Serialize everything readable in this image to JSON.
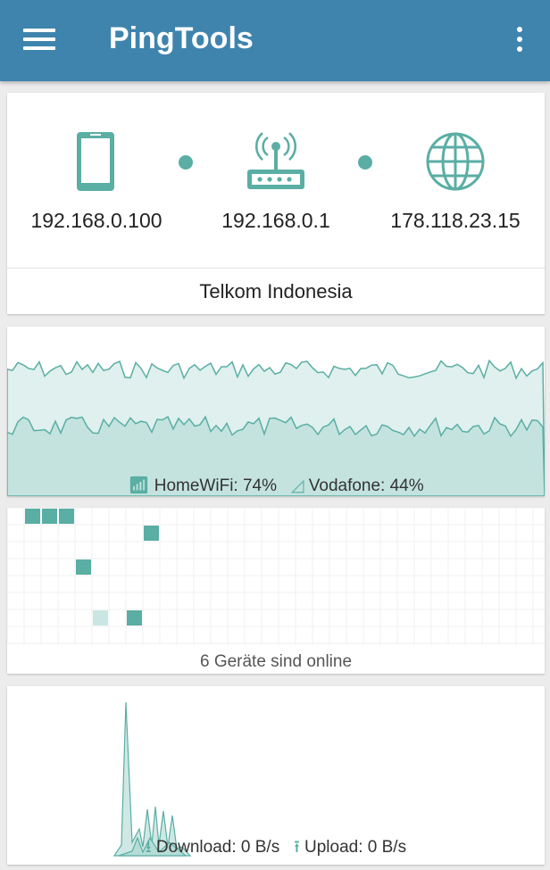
{
  "app_bar": {
    "title": "PingTools",
    "menu_icon": "hamburger-menu-icon",
    "more_icon": "more-vert-icon",
    "color": "#3f84ad"
  },
  "network": {
    "device_ip": "192.168.0.100",
    "gateway_ip": "192.168.0.1",
    "external_ip": "178.118.23.15",
    "isp": "Telkom Indonesia",
    "icons": [
      "phone-icon",
      "router-icon",
      "globe-icon"
    ],
    "accent_color": "#5aaea4"
  },
  "signal": {
    "wifi_label": "HomeWiFi: 74%",
    "cell_label": "Vodafone: 44%",
    "wifi_percent": 74,
    "cell_percent": 44,
    "fill_color": "#c9e6e2",
    "line_color": "#5aaea4"
  },
  "devices": {
    "status": "6 Geräte sind online",
    "online_count": 6
  },
  "traffic": {
    "download_label": "Download: 0 B/s",
    "upload_label": "Upload: 0 B/s"
  }
}
